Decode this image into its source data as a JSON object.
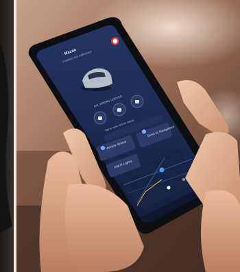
{
  "app": {
    "brand_line1": "Mazda",
    "brand_line2": "CONNECTED SERVICES",
    "user_initial": "C"
  },
  "vehicle_status": {
    "label": "ALL DOORS LOCKED",
    "sub_label": "Tap to view vehicle status"
  },
  "tiles": [
    {
      "label": "Vehicle Status"
    },
    {
      "label": "Send to Navigation"
    },
    {
      "label": "Alarm Lights"
    }
  ],
  "colors": {
    "screen_bg": "#1c2a4e",
    "accent_red": "#d1323c",
    "tile_bg": "#2b3d68"
  },
  "icons": [
    "lock-icon",
    "unlock-icon",
    "horn-icon",
    "car-icon",
    "map-pin-icon",
    "home-icon",
    "profile-icon"
  ]
}
